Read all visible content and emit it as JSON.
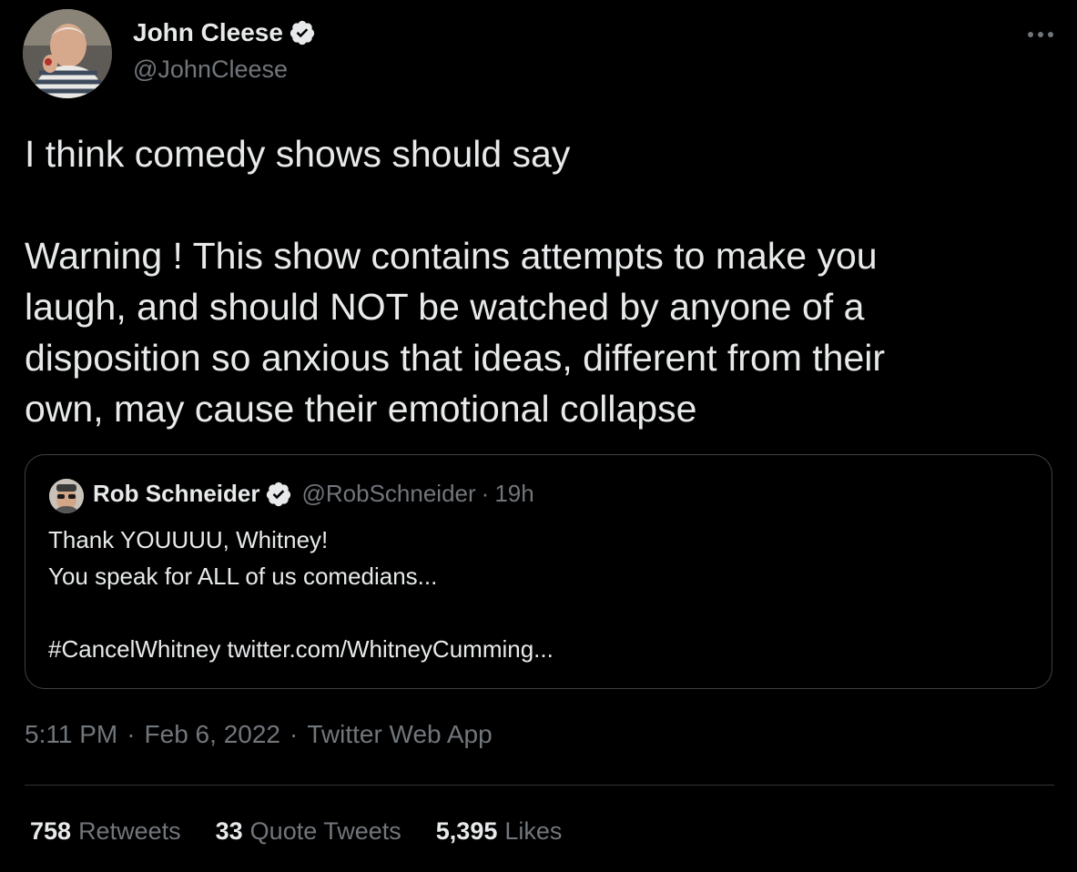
{
  "author": {
    "name": "John Cleese",
    "handle": "@JohnCleese"
  },
  "tweet": {
    "line1": "I think comedy shows should say",
    "line2": "Warning ! This show contains attempts to make you",
    "line3": "laugh, and should NOT be watched by anyone of a",
    "line4": "disposition so anxious that ideas, different from their",
    "line5": "own, may cause their emotional collapse"
  },
  "quote": {
    "name": "Rob Schneider",
    "handle": "@RobSchneider",
    "separator": "·",
    "time": "19h",
    "line1": "Thank YOUUUU, Whitney!",
    "line2": "You speak for ALL of us comedians...",
    "line3": "#CancelWhitney twitter.com/WhitneyCumming..."
  },
  "meta": {
    "time": "5:11 PM",
    "separator": "·",
    "date": "Feb 6, 2022",
    "source": "Twitter Web App"
  },
  "stats": [
    {
      "count": "758",
      "label": "Retweets"
    },
    {
      "count": "33",
      "label": "Quote Tweets"
    },
    {
      "count": "5,395",
      "label": "Likes"
    }
  ],
  "icons": {
    "verified": "verified-badge-icon",
    "more": "more-options-icon"
  },
  "colors": {
    "background": "#000000",
    "text": "#e7e9ea",
    "secondary": "#71767b",
    "border": "#3e4144",
    "divider": "#2f3336"
  }
}
